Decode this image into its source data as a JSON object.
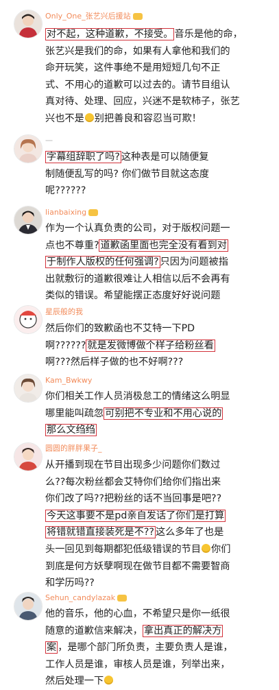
{
  "comments": [
    {
      "username": "Only_One_张艺兴后援站",
      "lines": [
        [
          {
            "t": "对不起，这种道歉，不接受。",
            "hl": true
          },
          {
            "t": "音乐是他的命，"
          }
        ],
        [
          {
            "t": "张艺兴是我们的命，如果有人拿他和我们的"
          }
        ],
        [
          {
            "t": "命开玩笑，这件事绝不是用短短几句不正"
          }
        ],
        [
          {
            "t": "式、不用心的道歉可以过去的。请节目组认"
          }
        ],
        [
          {
            "t": "真对待、处理、回应，兴迷不是软柿子，张艺"
          }
        ],
        [
          {
            "t": "兴也不是"
          },
          {
            "emoji": true
          },
          {
            "t": "别把善良和容忍当可欺！"
          }
        ]
      ]
    },
    {
      "username": "一",
      "lines": [
        [
          {
            "t": "字幕组辞职了吗?",
            "hl": true
          },
          {
            "t": "这种表是可以随便复"
          }
        ],
        [
          {
            "t": "制随便乱写的吗? 你们做节目就这态度"
          }
        ],
        [
          {
            "t": "呢??????"
          }
        ]
      ]
    },
    {
      "username": "lianbaixing",
      "lines": [
        [
          {
            "t": "作为一个认真负责的公司，对于版权问题一"
          }
        ],
        [
          {
            "t": "点也不尊重?"
          },
          {
            "t": "道歉函里面也完全没有看到对",
            "hl": true
          }
        ],
        [
          {
            "t": "于制作人版权的任何强调?",
            "hl": true
          },
          {
            "t": "只因为问题被指"
          }
        ],
        [
          {
            "t": "出就敷衍的道歉很难让人相信以后不会再有"
          }
        ],
        [
          {
            "t": "类似的错误。希望能摆正态度好好说问题"
          }
        ]
      ]
    },
    {
      "username": "星辰般的我",
      "lines": [
        [
          {
            "t": "然后你们的致歉函也不艾特一下PD"
          }
        ],
        [
          {
            "t": "啊??????"
          },
          {
            "t": "就是发微博做个样子给粉丝看",
            "hl": true
          }
        ],
        [
          {
            "t": "啊???然后样子做的也不好啊???"
          }
        ]
      ]
    },
    {
      "username": "Kam_Bwkwy",
      "lines": [
        [
          {
            "t": "你们相关工作人员消极怠工的情绪这么明显"
          }
        ],
        [
          {
            "t": "哪里能叫疏忽"
          },
          {
            "t": "可别把不专业和不用心说的",
            "hl": true
          }
        ],
        [
          {
            "t": "那么文绉绉",
            "hl": true
          }
        ]
      ]
    },
    {
      "username": "圆圆的胖胖果子_",
      "lines": [
        [
          {
            "t": "从开播到现在节目出现多少问题你们数过"
          }
        ],
        [
          {
            "t": "么??每次粉丝都会艾特你们给你们指出来"
          }
        ],
        [
          {
            "t": "你们改了吗??把粉丝的话不当回事是吧??"
          }
        ],
        [
          {
            "t": "今天这事要不是pd亲自发话了你们是打算",
            "hl": true
          }
        ],
        [
          {
            "t": "将错就错直接装死是不??",
            "hl": true
          },
          {
            "t": "这么多年了也是"
          }
        ],
        [
          {
            "t": "头一回见到每期都犯低级错误的节目"
          },
          {
            "emoji": true
          },
          {
            "t": "你们"
          }
        ],
        [
          {
            "t": "到底是何方妖孽啊现在做节目都不需要智商"
          }
        ],
        [
          {
            "t": "和学历吗??"
          }
        ]
      ]
    },
    {
      "username": "Sehun_candylazak",
      "lines": [
        [
          {
            "t": "他的音乐，他的心血，不希望只是你一纸很"
          }
        ],
        [
          {
            "t": "随意的道歉信来解决，"
          },
          {
            "t": "拿出真正的解决方",
            "hl": true
          }
        ],
        [
          {
            "t": "案",
            "hl": true
          },
          {
            "t": "，是哪个部门所负责，主要负责人是谁，"
          }
        ],
        [
          {
            "t": "工作人员是谁，审核人员是谁，列举出来，"
          }
        ],
        [
          {
            "t": "然后处理一下"
          },
          {
            "emoji": true
          }
        ]
      ]
    }
  ]
}
